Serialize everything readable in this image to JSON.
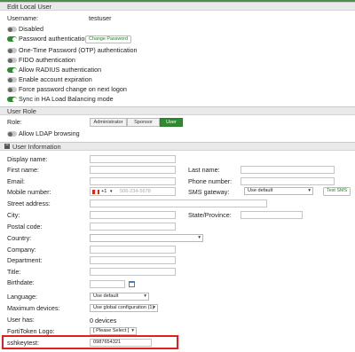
{
  "edit_local_user": {
    "header": "Edit Local User",
    "username_label": "Username:",
    "username_value": "testuser",
    "options": [
      {
        "label": "Disabled",
        "on": false
      },
      {
        "label": "Password authentication",
        "on": true
      },
      {
        "label": "One-Time Password (OTP) authentication",
        "on": false
      },
      {
        "label": "FIDO authentication",
        "on": false
      },
      {
        "label": "Allow RADIUS authentication",
        "on": true
      },
      {
        "label": "Enable account expiration",
        "on": false
      },
      {
        "label": "Force password change on next logon",
        "on": false
      },
      {
        "label": "Sync in HA Load Balancing mode",
        "on": true
      }
    ],
    "change_password_button": "Change Password"
  },
  "user_role": {
    "header": "User Role",
    "role_label": "Role:",
    "roles": [
      "Administrator",
      "Sponsor",
      "User"
    ],
    "selected_role": "User",
    "ldap_toggle_label": "Allow LDAP browsing"
  },
  "user_information": {
    "header": "User Information",
    "display_name_label": "Display name:",
    "first_name_label": "First name:",
    "last_name_label": "Last name:",
    "email_label": "Email:",
    "phone_label": "Phone number:",
    "mobile_label": "Mobile number:",
    "mobile_country_code": "+1",
    "mobile_placeholder": "506-234-5678",
    "sms_gateway_label": "SMS gateway:",
    "sms_gateway_value": "Use default",
    "test_sms_button": "Test SMS",
    "street_label": "Street address:",
    "city_label": "City:",
    "state_label": "State/Province:",
    "postal_label": "Postal code:",
    "country_label": "Country:",
    "company_label": "Company:",
    "department_label": "Department:",
    "title_label": "Title:",
    "birthdate_label": "Birthdate:",
    "language_label": "Language:",
    "language_value": "Use default",
    "max_devices_label": "Maximum devices:",
    "max_devices_value": "Use global configuration (1)",
    "user_has_label": "User has:",
    "user_has_value": "0 devices",
    "fortitoken_label": "FortiToken Logo:",
    "fortitoken_value": "[ Please Select ]",
    "sshkeytest_label": "sshkeytest:",
    "sshkeytest_value": "0987654321"
  },
  "colors": {
    "accent_green": "#2e8b2e",
    "highlight_red": "#e01f1f"
  }
}
